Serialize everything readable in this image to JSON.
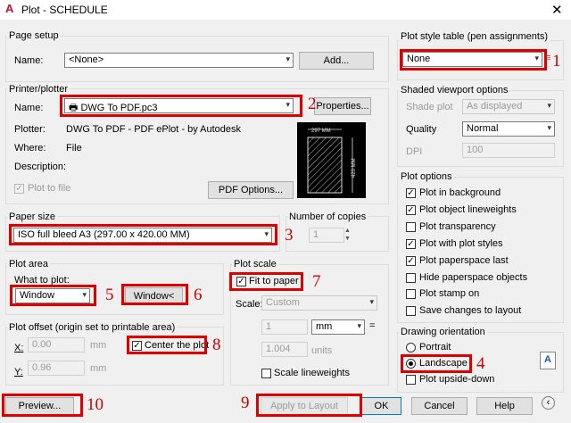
{
  "window": {
    "title": "Plot - SCHEDULE",
    "app_icon_glyph": "A",
    "close_glyph": "✕"
  },
  "page_setup": {
    "group_label": "Page setup",
    "name_label": "Name:",
    "name_value": "<None>",
    "add_button": "Add..."
  },
  "printer": {
    "group_label": "Printer/plotter",
    "name_label": "Name:",
    "name_value": "DWG To PDF.pc3",
    "properties_button": "Properties...",
    "plotter_label": "Plotter:",
    "plotter_value": "DWG To PDF - PDF ePlot - by Autodesk",
    "where_label": "Where:",
    "where_value": "File",
    "description_label": "Description:",
    "plot_to_file_label": "Plot to file",
    "pdf_options_button": "PDF Options...",
    "preview_width": "297 MM",
    "preview_height": "420 MM"
  },
  "paper_size": {
    "group_label": "Paper size",
    "value": "ISO full bleed A3 (297.00 x 420.00 MM)"
  },
  "copies": {
    "label": "Number of copies",
    "value": "1"
  },
  "plot_area": {
    "group_label": "Plot area",
    "what_label": "What to plot:",
    "what_value": "Window",
    "window_button": "Window<"
  },
  "plot_offset": {
    "group_label": "Plot offset (origin set to printable area)",
    "x_label": "X:",
    "x_value": "0.00",
    "x_unit": "mm",
    "y_label": "Y:",
    "y_value": "0.96",
    "y_unit": "mm",
    "center_label": "Center the plot"
  },
  "plot_scale": {
    "group_label": "Plot scale",
    "fit_label": "Fit to paper",
    "scale_label": "Scale:",
    "scale_value": "Custom",
    "value1": "1",
    "unit": "mm",
    "equals": "=",
    "value2": "1.004",
    "units_label": "units",
    "lineweights_label": "Scale lineweights"
  },
  "plot_style": {
    "group_label": "Plot style table (pen assignments)",
    "value": "None",
    "edit_icon": "≡"
  },
  "shaded": {
    "group_label": "Shaded viewport options",
    "shade_label": "Shade plot",
    "shade_value": "As displayed",
    "quality_label": "Quality",
    "quality_value": "Normal",
    "dpi_label": "DPI",
    "dpi_value": "100"
  },
  "plot_options": {
    "group_label": "Plot options",
    "items": [
      {
        "label": "Plot in background",
        "checked": true
      },
      {
        "label": "Plot object lineweights",
        "checked": true
      },
      {
        "label": "Plot transparency",
        "checked": false
      },
      {
        "label": "Plot with plot styles",
        "checked": true
      },
      {
        "label": "Plot paperspace last",
        "checked": true
      },
      {
        "label": "Hide paperspace objects",
        "checked": false
      },
      {
        "label": "Plot stamp on",
        "checked": false
      },
      {
        "label": "Save changes to layout",
        "checked": false
      }
    ]
  },
  "orientation": {
    "group_label": "Drawing orientation",
    "portrait_label": "Portrait",
    "landscape_label": "Landscape",
    "upside_down_label": "Plot upside-down",
    "selected": "Landscape"
  },
  "footer": {
    "preview_button": "Preview...",
    "apply_button": "Apply to Layout",
    "ok_button": "OK",
    "cancel_button": "Cancel",
    "help_button": "Help",
    "collapse_icon": "‹"
  },
  "annotations": [
    "1",
    "2",
    "3",
    "4",
    "5",
    "6",
    "7",
    "8",
    "9",
    "10"
  ],
  "colors": {
    "annotation_red": "#e00000",
    "window_bg": "#f0f0f0",
    "app_icon_red": "#c8102e"
  }
}
